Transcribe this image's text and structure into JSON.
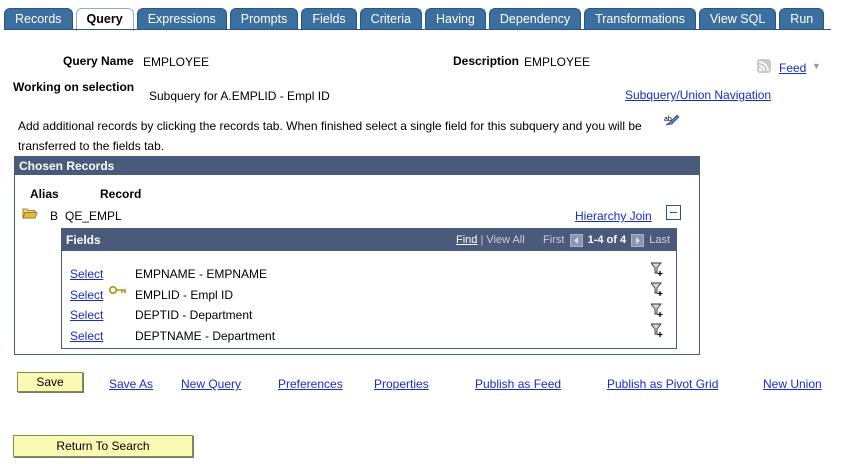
{
  "tabs": [
    "Records",
    "Query",
    "Expressions",
    "Prompts",
    "Fields",
    "Criteria",
    "Having",
    "Dependency",
    "Transformations",
    "View SQL",
    "Run"
  ],
  "active_tab": "Query",
  "query_name_label": "Query Name",
  "query_name_value": "EMPLOYEE",
  "description_label": "Description",
  "description_value": "EMPLOYEE",
  "feed_label": "Feed",
  "working_label": "Working on selection",
  "working_value": "Subquery for A.EMPLID - Empl ID",
  "subquery_nav": "Subquery/Union Navigation",
  "instructions": {
    "line1": "Add additional records by clicking the records tab. When finished select a single field for this subquery and you will be",
    "line2": "transferred to the fields tab."
  },
  "chosen": {
    "title": "Chosen Records",
    "col_alias": "Alias",
    "col_record": "Record",
    "alias": "B",
    "record": "QE_EMPL",
    "hierarchy_join": "Hierarchy Join"
  },
  "fields": {
    "title": "Fields",
    "find": "Find",
    "view_all": "View All",
    "first": "First",
    "range": "1-4 of 4",
    "last": "Last",
    "rows": [
      {
        "select": "Select",
        "name": "EMPNAME - EMPNAME",
        "key": false
      },
      {
        "select": "Select",
        "name": "EMPLID - Empl ID",
        "key": true
      },
      {
        "select": "Select",
        "name": "DEPTID - Department",
        "key": false
      },
      {
        "select": "Select",
        "name": "DEPTNAME - Department",
        "key": false
      }
    ]
  },
  "actions": {
    "save": "Save",
    "save_as": "Save As",
    "new_query": "New Query",
    "preferences": "Preferences",
    "properties": "Properties",
    "publish_feed": "Publish as Feed",
    "publish_pivot": "Publish as Pivot Grid",
    "new_union": "New Union"
  },
  "return_to_search": "Return To Search"
}
